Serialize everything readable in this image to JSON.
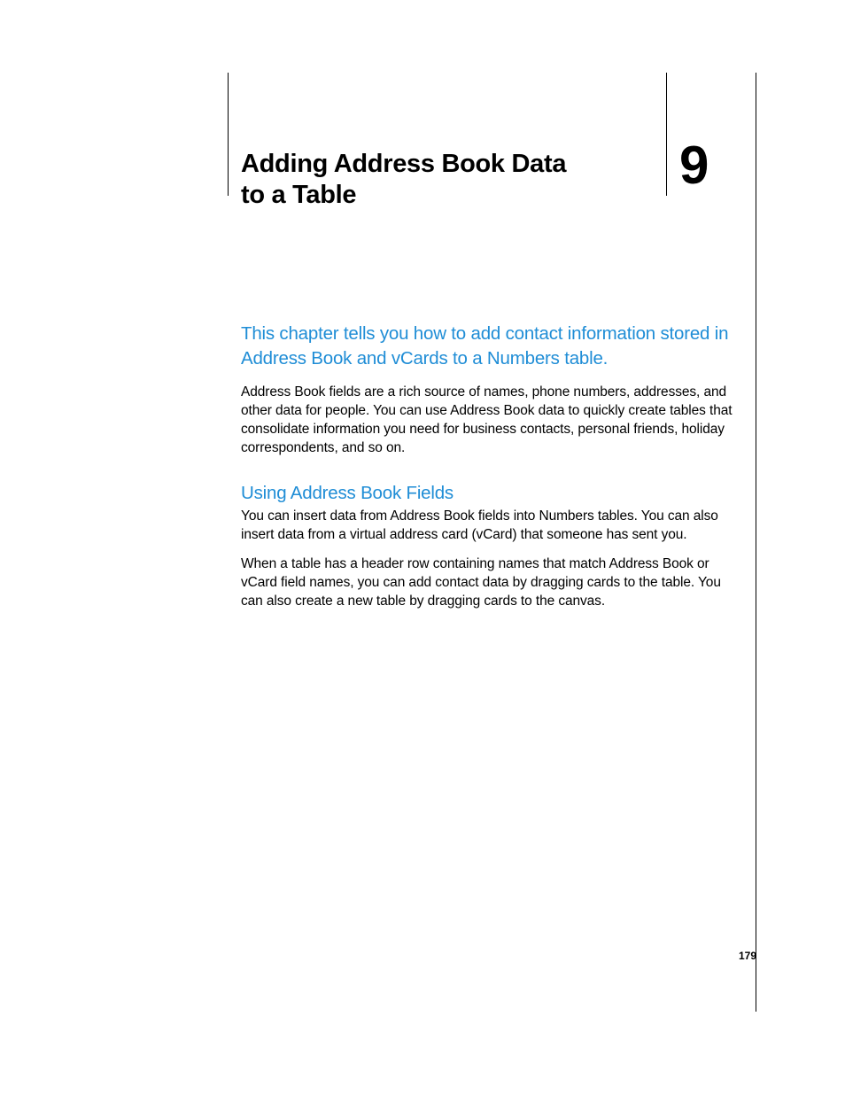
{
  "chapter": {
    "title_line1": "Adding Address Book Data",
    "title_line2": "to a Table",
    "number": "9"
  },
  "intro": "This chapter tells you how to add contact information stored in Address Book and vCards to a Numbers table.",
  "paragraphs": {
    "intro_body": "Address Book fields are a rich source of names, phone numbers, addresses, and other data for people. You can use Address Book data to quickly create tables that consolidate information you need for business contacts, personal friends, holiday correspondents, and so on."
  },
  "section": {
    "heading": "Using Address Book Fields",
    "p1": "You can insert data from Address Book fields into Numbers tables. You can also insert data from a virtual address card (vCard) that someone has sent you.",
    "p2": "When a table has a header row containing names that match Address Book or vCard field names, you can add contact data by dragging cards to the table. You can also create a new table by dragging cards to the canvas."
  },
  "page_number": "179"
}
